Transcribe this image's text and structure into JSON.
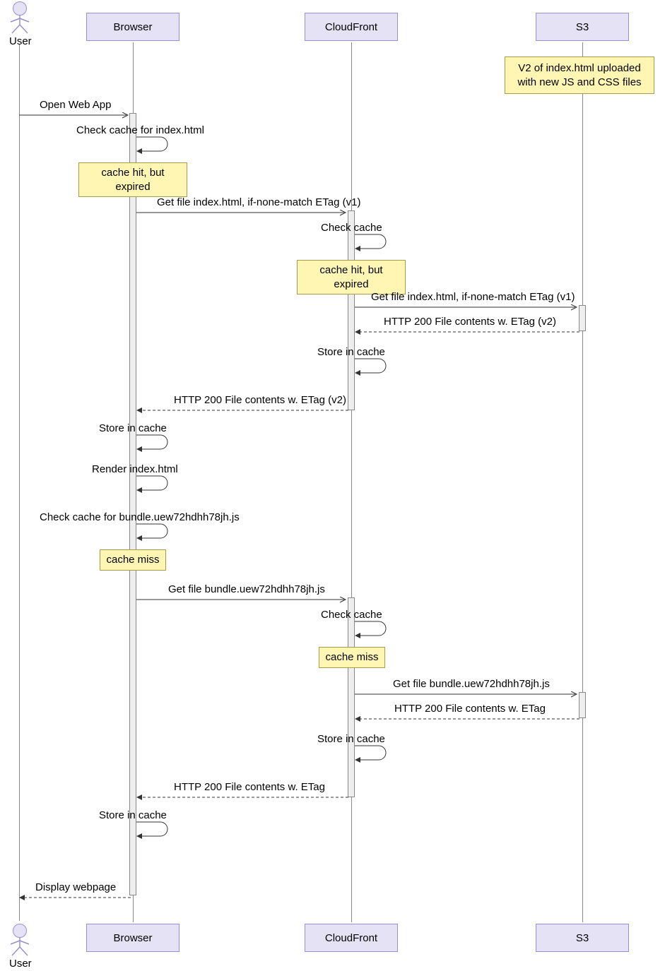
{
  "actors": {
    "user": "User",
    "browser": "Browser",
    "cloudfront": "CloudFront",
    "s3": "S3"
  },
  "notes": {
    "n0": "V2 of index.html uploaded with new JS and CSS files",
    "n1": "cache hit, but expired",
    "n2": "cache hit, but expired",
    "n3": "cache miss",
    "n4": "cache miss"
  },
  "messages": {
    "m1": "Open Web App",
    "m2": "Check cache for index.html",
    "m3": "Get file index.html, if-none-match ETag (v1)",
    "m4": "Check cache",
    "m5": "Get file index.html, if-none-match ETag (v1)",
    "m6": "HTTP 200 File contents w. ETag (v2)",
    "m7": "Store in cache",
    "m8": "HTTP 200 File contents w. ETag (v2)",
    "m9": "Store in cache",
    "m10": "Render index.html",
    "m11": "Check cache for bundle.uew72hdhh78jh.js",
    "m12": "Get file bundle.uew72hdhh78jh.js",
    "m13": "Check cache",
    "m14": "Get file bundle.uew72hdhh78jh.js",
    "m15": "HTTP 200 File contents w. ETag",
    "m16": "Store in cache",
    "m17": "HTTP 200 File contents w. ETag",
    "m18": "Store in cache",
    "m19": "Display webpage"
  },
  "chart_data": {
    "type": "sequence-diagram",
    "participants": [
      "User",
      "Browser",
      "CloudFront",
      "S3"
    ],
    "events": [
      {
        "kind": "note",
        "over": "S3",
        "text": "V2 of index.html uploaded with new JS and CSS files"
      },
      {
        "kind": "msg",
        "from": "User",
        "to": "Browser",
        "text": "Open Web App",
        "dir": "async"
      },
      {
        "kind": "self",
        "on": "Browser",
        "text": "Check cache for index.html"
      },
      {
        "kind": "note",
        "over": "Browser",
        "text": "cache hit, but expired"
      },
      {
        "kind": "msg",
        "from": "Browser",
        "to": "CloudFront",
        "text": "Get file index.html, if-none-match ETag (v1)",
        "dir": "async"
      },
      {
        "kind": "self",
        "on": "CloudFront",
        "text": "Check cache"
      },
      {
        "kind": "note",
        "over": "CloudFront",
        "text": "cache hit, but expired"
      },
      {
        "kind": "msg",
        "from": "CloudFront",
        "to": "S3",
        "text": "Get file index.html, if-none-match ETag (v1)",
        "dir": "async"
      },
      {
        "kind": "msg",
        "from": "S3",
        "to": "CloudFront",
        "text": "HTTP 200 File contents w. ETag (v2)",
        "dir": "sync",
        "dashed": true
      },
      {
        "kind": "self",
        "on": "CloudFront",
        "text": "Store in cache"
      },
      {
        "kind": "msg",
        "from": "CloudFront",
        "to": "Browser",
        "text": "HTTP 200 File contents w. ETag (v2)",
        "dir": "sync",
        "dashed": true
      },
      {
        "kind": "self",
        "on": "Browser",
        "text": "Store in cache"
      },
      {
        "kind": "self",
        "on": "Browser",
        "text": "Render index.html"
      },
      {
        "kind": "self",
        "on": "Browser",
        "text": "Check cache for bundle.uew72hdhh78jh.js"
      },
      {
        "kind": "note",
        "over": "Browser",
        "text": "cache miss"
      },
      {
        "kind": "msg",
        "from": "Browser",
        "to": "CloudFront",
        "text": "Get file bundle.uew72hdhh78jh.js",
        "dir": "async"
      },
      {
        "kind": "self",
        "on": "CloudFront",
        "text": "Check cache"
      },
      {
        "kind": "note",
        "over": "CloudFront",
        "text": "cache miss"
      },
      {
        "kind": "msg",
        "from": "CloudFront",
        "to": "S3",
        "text": "Get file bundle.uew72hdhh78jh.js",
        "dir": "async"
      },
      {
        "kind": "msg",
        "from": "S3",
        "to": "CloudFront",
        "text": "HTTP 200 File contents w. ETag",
        "dir": "sync",
        "dashed": true
      },
      {
        "kind": "self",
        "on": "CloudFront",
        "text": "Store in cache"
      },
      {
        "kind": "msg",
        "from": "CloudFront",
        "to": "Browser",
        "text": "HTTP 200 File contents w. ETag",
        "dir": "sync",
        "dashed": true
      },
      {
        "kind": "self",
        "on": "Browser",
        "text": "Store in cache"
      },
      {
        "kind": "msg",
        "from": "Browser",
        "to": "User",
        "text": "Display webpage",
        "dir": "sync",
        "dashed": true
      }
    ]
  }
}
